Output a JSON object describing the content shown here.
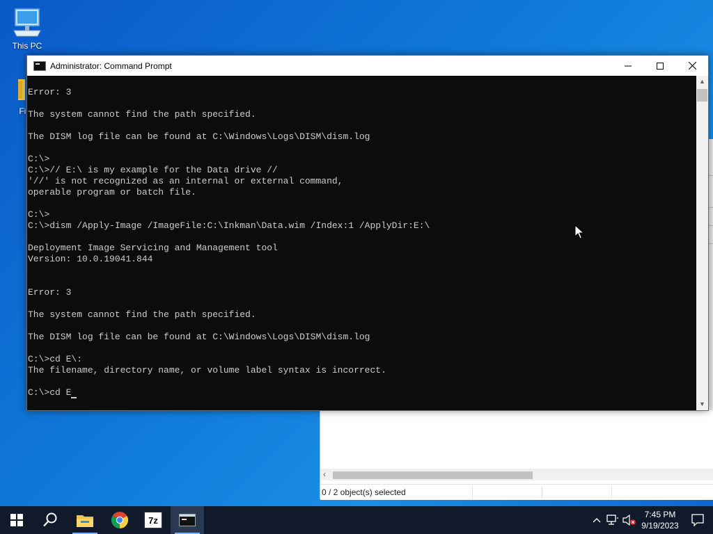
{
  "desktop": {
    "icons": [
      {
        "label": "This PC"
      },
      {
        "label": "Fil"
      }
    ]
  },
  "explorer": {
    "status_text": "0 / 2 object(s) selected"
  },
  "cmd": {
    "title": "Administrator: Command Prompt",
    "lines": [
      "",
      "Error: 3",
      "",
      "The system cannot find the path specified.",
      "",
      "The DISM log file can be found at C:\\Windows\\Logs\\DISM\\dism.log",
      "",
      "C:\\>",
      "C:\\>// E:\\ is my example for the Data drive //",
      "'//' is not recognized as an internal or external command,",
      "operable program or batch file.",
      "",
      "C:\\>",
      "C:\\>dism /Apply-Image /ImageFile:C:\\Inkman\\Data.wim /Index:1 /ApplyDir:E:\\",
      "",
      "Deployment Image Servicing and Management tool",
      "Version: 10.0.19041.844",
      "",
      "",
      "Error: 3",
      "",
      "The system cannot find the path specified.",
      "",
      "The DISM log file can be found at C:\\Windows\\Logs\\DISM\\dism.log",
      "",
      "C:\\>cd E\\:",
      "The filename, directory name, or volume label syntax is incorrect.",
      "",
      "C:\\>cd E"
    ]
  },
  "taskbar": {
    "apps": [
      {
        "icon": "file-explorer-icon"
      },
      {
        "icon": "chrome-icon"
      },
      {
        "icon": "7zip-icon",
        "text": "7z"
      },
      {
        "icon": "command-prompt-icon"
      }
    ],
    "clock": {
      "time": "7:45 PM",
      "date": "9/19/2023"
    }
  },
  "colors": {
    "console_bg": "#0c0c0c",
    "console_fg": "#cccccc",
    "taskbar_bg": "#101a2a"
  }
}
